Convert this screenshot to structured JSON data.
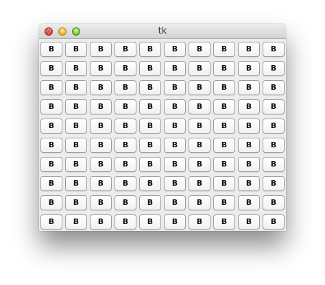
{
  "window": {
    "title": "tk"
  },
  "buttons": {
    "rows": 10,
    "columns": 10,
    "label": "B"
  }
}
